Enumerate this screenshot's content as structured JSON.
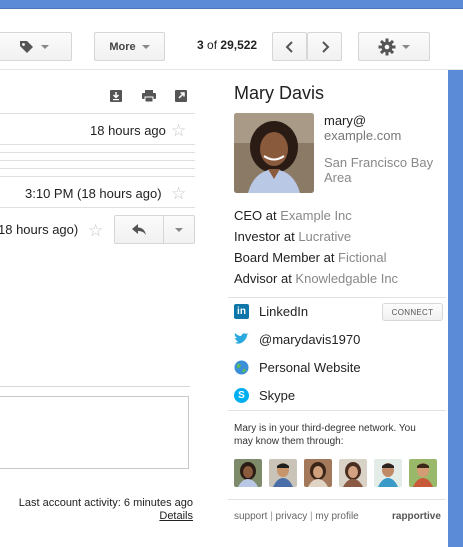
{
  "toolbar": {
    "more_label": "More",
    "pager_current": "3",
    "pager_of": "of",
    "pager_total": "29,522"
  },
  "messages": [
    {
      "time": "18 hours ago"
    },
    {
      "time": "3:10 PM (18 hours ago)"
    },
    {
      "time": "18 hours ago)"
    }
  ],
  "footer": {
    "activity": "Last account activity: 6 minutes ago",
    "details": "Details"
  },
  "profile": {
    "name": "Mary Davis",
    "email_line1": "mary@",
    "email_line2": "example.com",
    "location": "San Francisco Bay Area",
    "roles": [
      {
        "title": "CEO at ",
        "org": "Example Inc"
      },
      {
        "title": "Investor at ",
        "org": "Lucrative"
      },
      {
        "title": "Board Member at ",
        "org": "Fictional"
      },
      {
        "title": "Advisor at ",
        "org": "Knowledgable Inc"
      }
    ],
    "social": [
      {
        "label": "LinkedIn",
        "icon": "linkedin-icon"
      },
      {
        "label": "@marydavis1970",
        "icon": "twitter-icon"
      },
      {
        "label": "Personal Website",
        "icon": "globe-icon"
      },
      {
        "label": "Skype",
        "icon": "skype-icon"
      }
    ],
    "connect_label": "CONNECT",
    "network_text": "Mary is in your third-degree network. You may know them through:",
    "footer_links": [
      "support",
      "privacy",
      "my profile"
    ],
    "brand": "rapportive"
  },
  "colors": {
    "accent_blue": "#5b8ad6",
    "org_gray": "#888888",
    "linkedin": "#0e76a8",
    "twitter": "#2aa9e0",
    "skype": "#00aff0"
  }
}
